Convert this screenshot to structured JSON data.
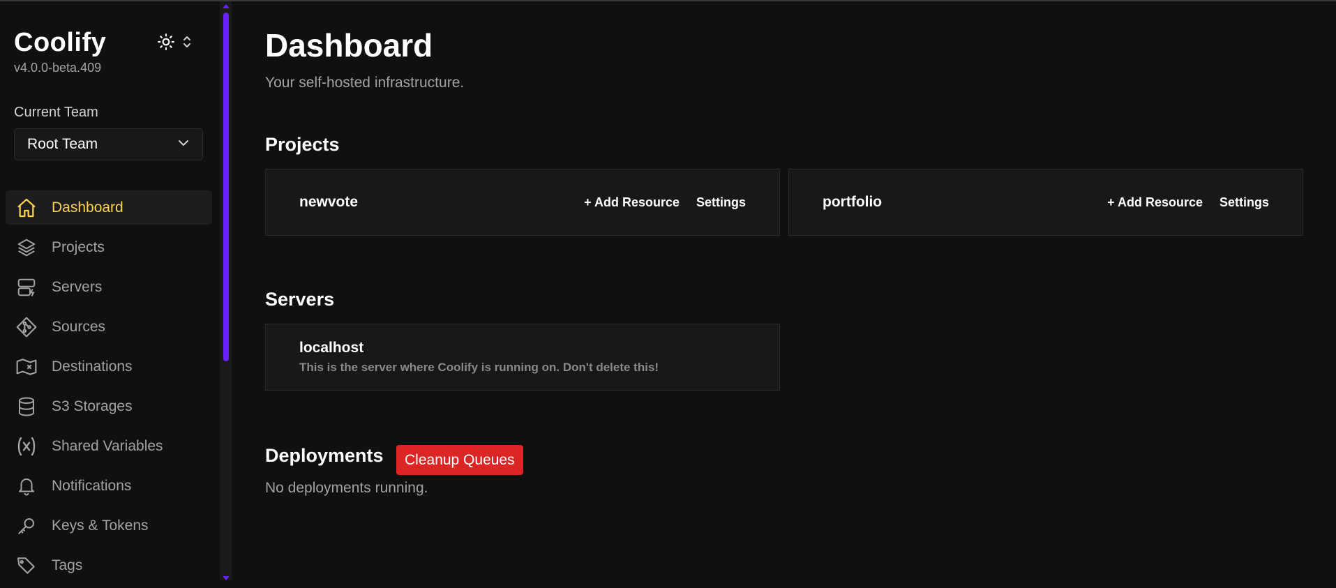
{
  "brand": {
    "name": "Coolify",
    "version": "v4.0.0-beta.409"
  },
  "team": {
    "label": "Current Team",
    "value": "Root Team"
  },
  "nav": [
    {
      "label": "Dashboard",
      "icon": "home-icon",
      "active": true
    },
    {
      "label": "Projects",
      "icon": "layers-icon"
    },
    {
      "label": "Servers",
      "icon": "server-icon"
    },
    {
      "label": "Sources",
      "icon": "git-icon"
    },
    {
      "label": "Destinations",
      "icon": "map-icon"
    },
    {
      "label": "S3 Storages",
      "icon": "database-icon"
    },
    {
      "label": "Shared Variables",
      "icon": "variable-icon"
    },
    {
      "label": "Notifications",
      "icon": "bell-icon"
    },
    {
      "label": "Keys & Tokens",
      "icon": "key-icon"
    },
    {
      "label": "Tags",
      "icon": "tags-icon"
    }
  ],
  "main": {
    "title": "Dashboard",
    "subtitle": "Your self-hosted infrastructure.",
    "projects_title": "Projects",
    "projects": [
      {
        "name": "newvote",
        "add_label": "+ Add Resource",
        "settings_label": "Settings"
      },
      {
        "name": "portfolio",
        "add_label": "+ Add Resource",
        "settings_label": "Settings"
      }
    ],
    "servers_title": "Servers",
    "servers": [
      {
        "name": "localhost",
        "description": "This is the server where Coolify is running on. Don't delete this!"
      }
    ],
    "deployments_title": "Deployments",
    "cleanup_label": "Cleanup Queues",
    "no_deployments": "No deployments running."
  },
  "colors": {
    "accent": "#fcd34d",
    "danger": "#dc2626",
    "scroll": "#6b21ff",
    "background": "#101010"
  }
}
